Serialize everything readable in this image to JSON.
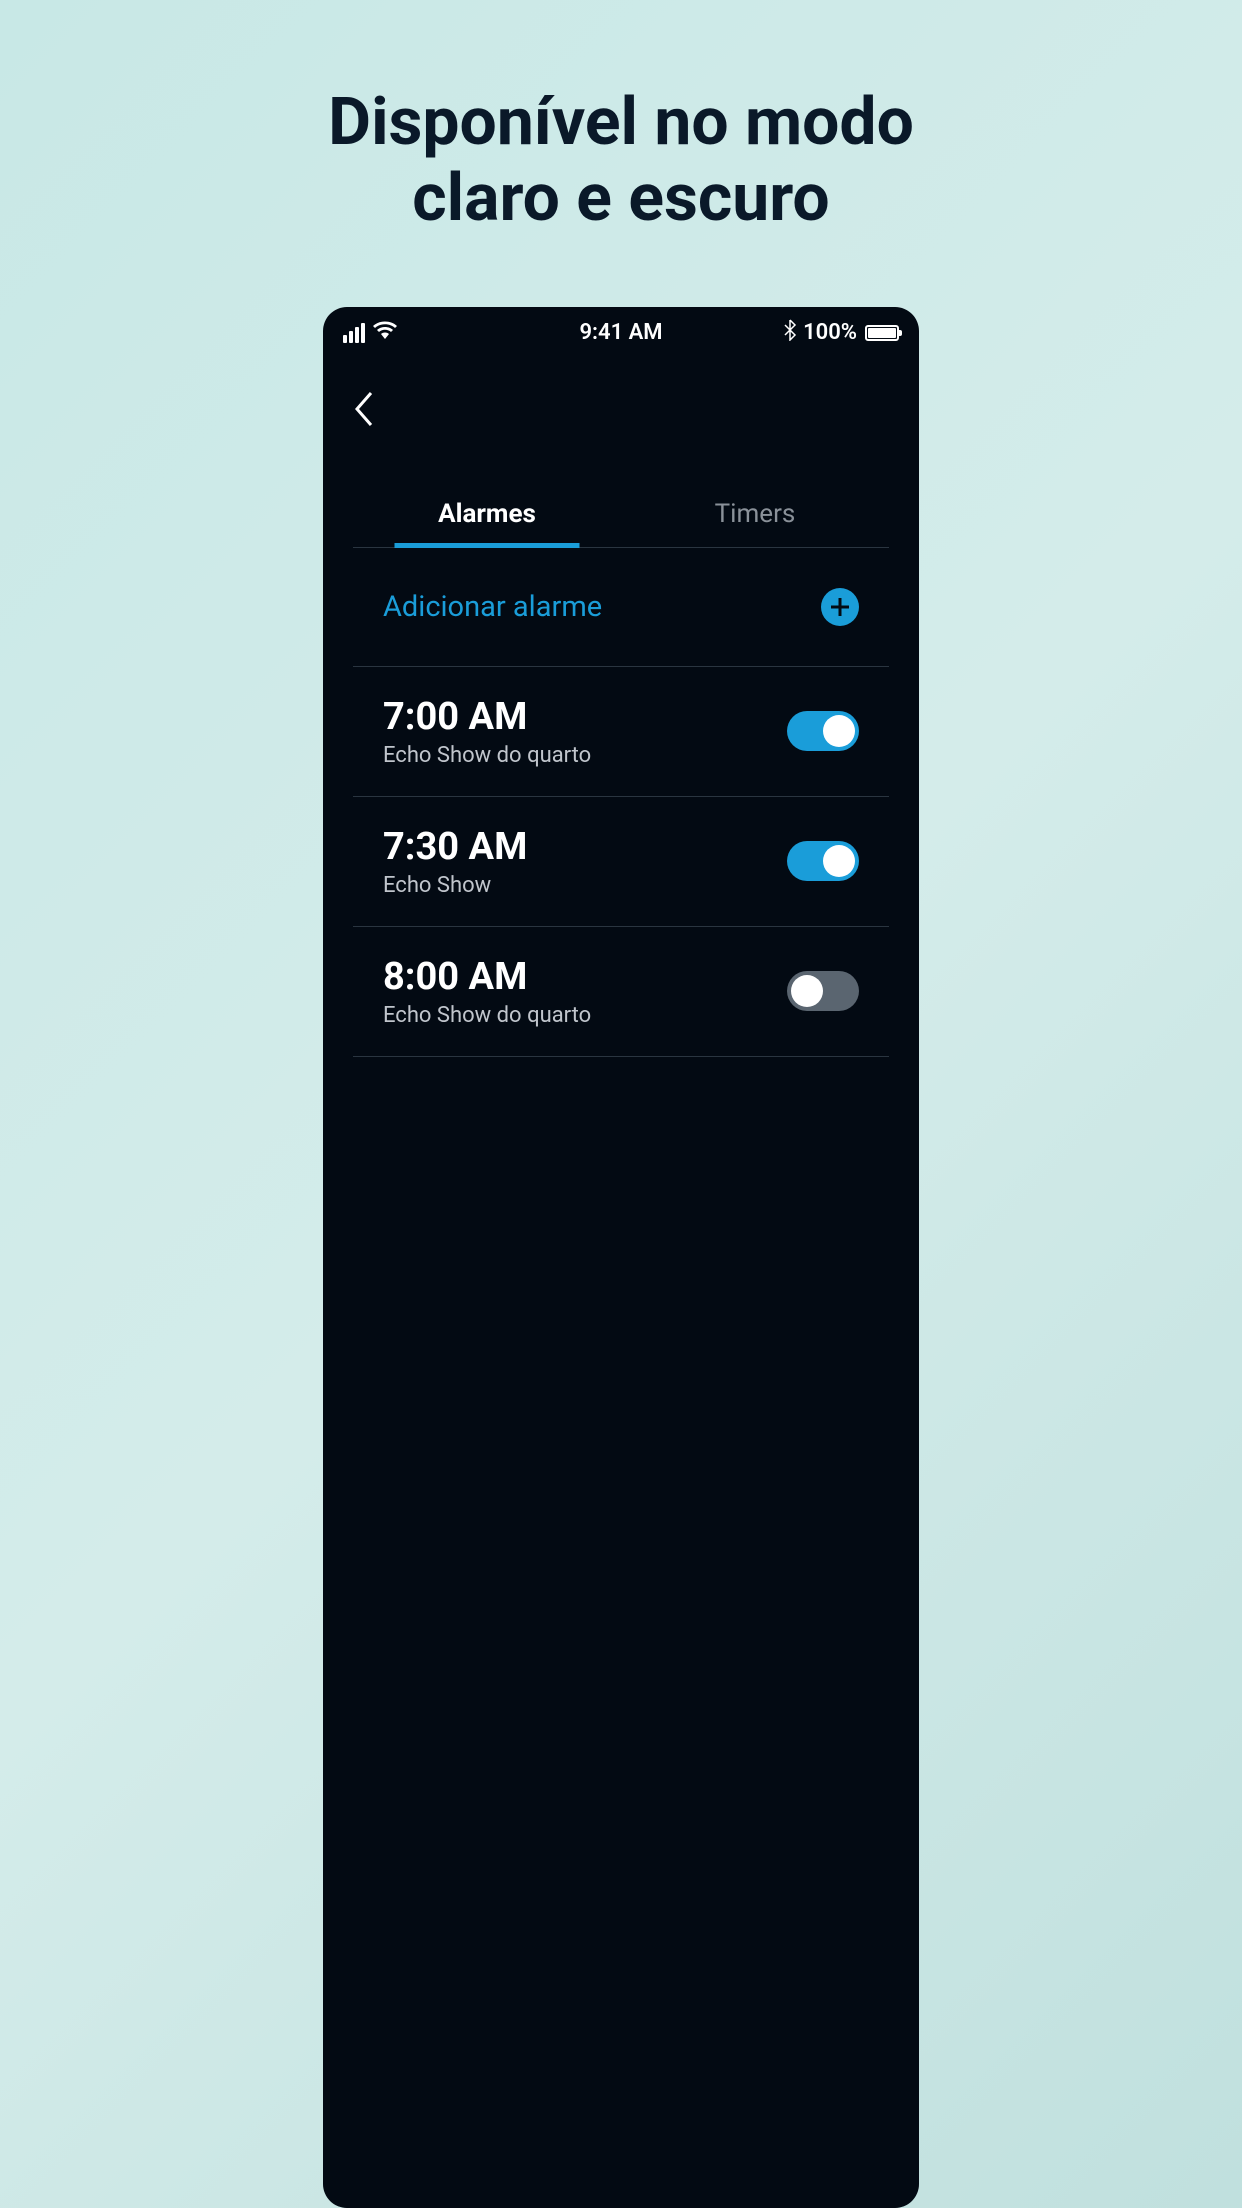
{
  "promo": {
    "title_line1": "Disponível no modo",
    "title_line2": "claro e escuro"
  },
  "status_bar": {
    "time": "9:41 AM",
    "battery_percent": "100%"
  },
  "tabs": {
    "alarms": "Alarmes",
    "timers": "Timers"
  },
  "add_alarm": {
    "label": "Adicionar alarme"
  },
  "alarms": [
    {
      "time": "7:00 AM",
      "device": "Echo Show do quarto",
      "enabled": true
    },
    {
      "time": "7:30 AM",
      "device": "Echo Show",
      "enabled": true
    },
    {
      "time": "8:00 AM",
      "device": "Echo Show do quarto",
      "enabled": false
    }
  ]
}
